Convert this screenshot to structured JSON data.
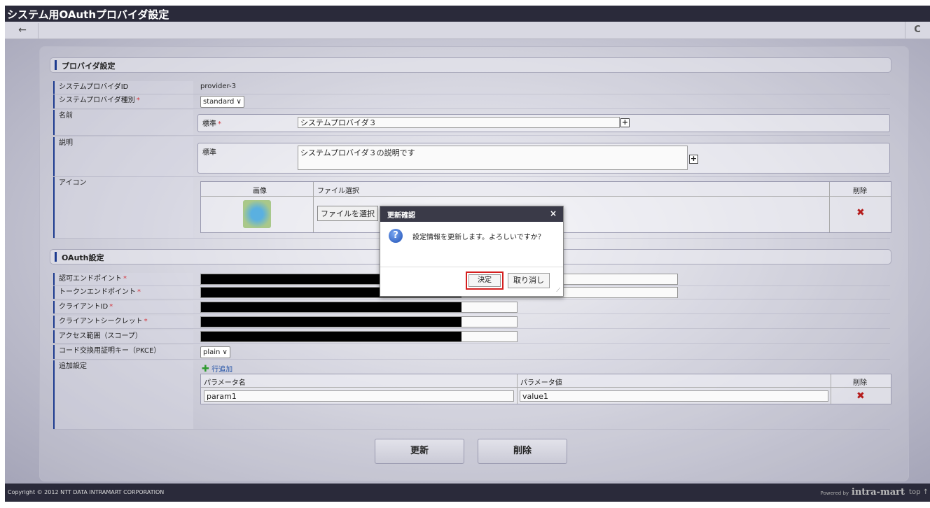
{
  "window": {
    "title": "システム用OAuthプロバイダ設定"
  },
  "toolbar": {
    "back_icon": "←",
    "reload_icon": "C"
  },
  "provider_section": {
    "heading": "プロバイダ設定",
    "provider_id_label": "システムプロバイダID",
    "provider_id_value": "provider-3",
    "provider_type_label": "システムプロバイダ種別",
    "provider_type_value": "standard ∨",
    "required_mark": "*",
    "name_label": "名前",
    "name_locale_label": "標準",
    "name_value": "システムプロバイダ３",
    "description_label": "説明",
    "description_locale_label": "標準",
    "description_value": "システムプロバイダ３の説明です",
    "icon_label": "アイコン",
    "icon_table": {
      "col_image": "画像",
      "col_file": "ファイル選択",
      "col_delete": "削除",
      "file_button": "ファイルを選択"
    }
  },
  "oauth_section": {
    "heading": "OAuth設定",
    "auth_endpoint_label": "認可エンドポイント",
    "token_endpoint_label": "トークンエンドポイント",
    "client_id_label": "クライアントID",
    "client_secret_label": "クライアントシークレット",
    "scope_label": "アクセス範囲（スコープ）",
    "pkce_label": "コード交換用証明キー（PKCE）",
    "pkce_value": "plain ∨",
    "extra_label": "追加設定",
    "add_row_label": "行追加",
    "param_table": {
      "col_name": "パラメータ名",
      "col_value": "パラメータ値",
      "col_delete": "削除",
      "rows": [
        {
          "name": "param1",
          "value": "value1"
        }
      ]
    }
  },
  "actions": {
    "update_label": "更新",
    "delete_label": "削除"
  },
  "dialog": {
    "title": "更新確認",
    "close": "×",
    "message": "設定情報を更新します。よろしいですか？",
    "ok_label": "決定",
    "cancel_label": "取り消し"
  },
  "footer": {
    "copyright": "Copyright © 2012 NTT DATA INTRAMART CORPORATION",
    "powered_by": "Powered by",
    "brand": "intra-mart",
    "top_link": "top ↑"
  }
}
